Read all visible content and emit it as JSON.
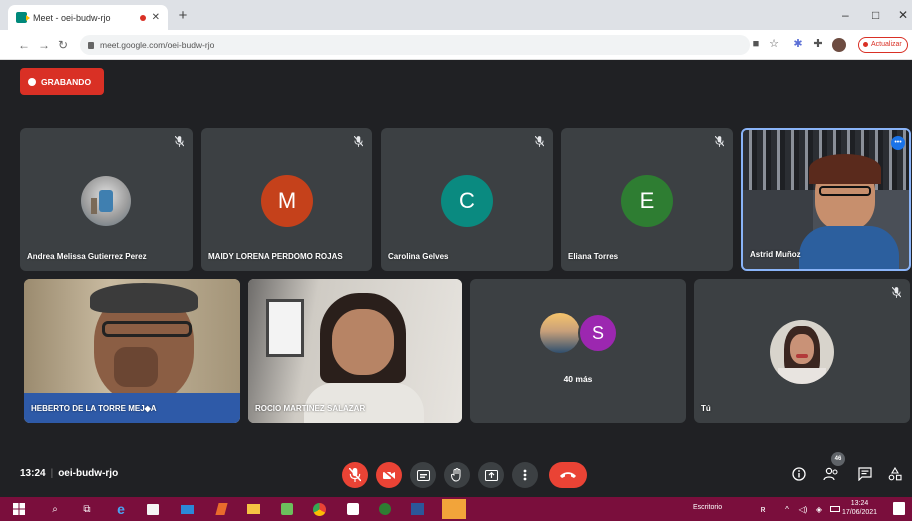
{
  "browser": {
    "tab_title": "Meet - oei-budw-rjo",
    "url": "meet.google.com/oei-budw-rjo",
    "update_label": "Actualizar"
  },
  "recording": {
    "label": "GRABANDO"
  },
  "tiles": [
    {
      "name": "Andrea Melissa Gutierrez Perez",
      "type": "photo"
    },
    {
      "name": "MAIDY LORENA PERDOMO ROJAS",
      "type": "letter",
      "letter": "M",
      "color": "#c5411b"
    },
    {
      "name": "Carolina Gelves",
      "type": "letter",
      "letter": "C",
      "color": "#0a8a80"
    },
    {
      "name": "Eliana Torres",
      "type": "letter",
      "letter": "E",
      "color": "#2e7d32"
    },
    {
      "name": "Astrid Muñoz",
      "type": "video"
    },
    {
      "name": "HEBERTO DE LA TORRE MEJ◆A",
      "type": "video"
    },
    {
      "name": "ROCIO MARTINEZ SALAZAR",
      "type": "video"
    },
    {
      "name": "40 más",
      "type": "more",
      "letter": "S"
    },
    {
      "name": "Tú",
      "type": "photo"
    }
  ],
  "bottom_bar": {
    "time": "13:24",
    "meeting_code": "oei-budw-rjo",
    "participants_count": "46"
  },
  "taskbar": {
    "search_label": "Escritorio",
    "time": "13:24",
    "date": "17/06/2021"
  }
}
